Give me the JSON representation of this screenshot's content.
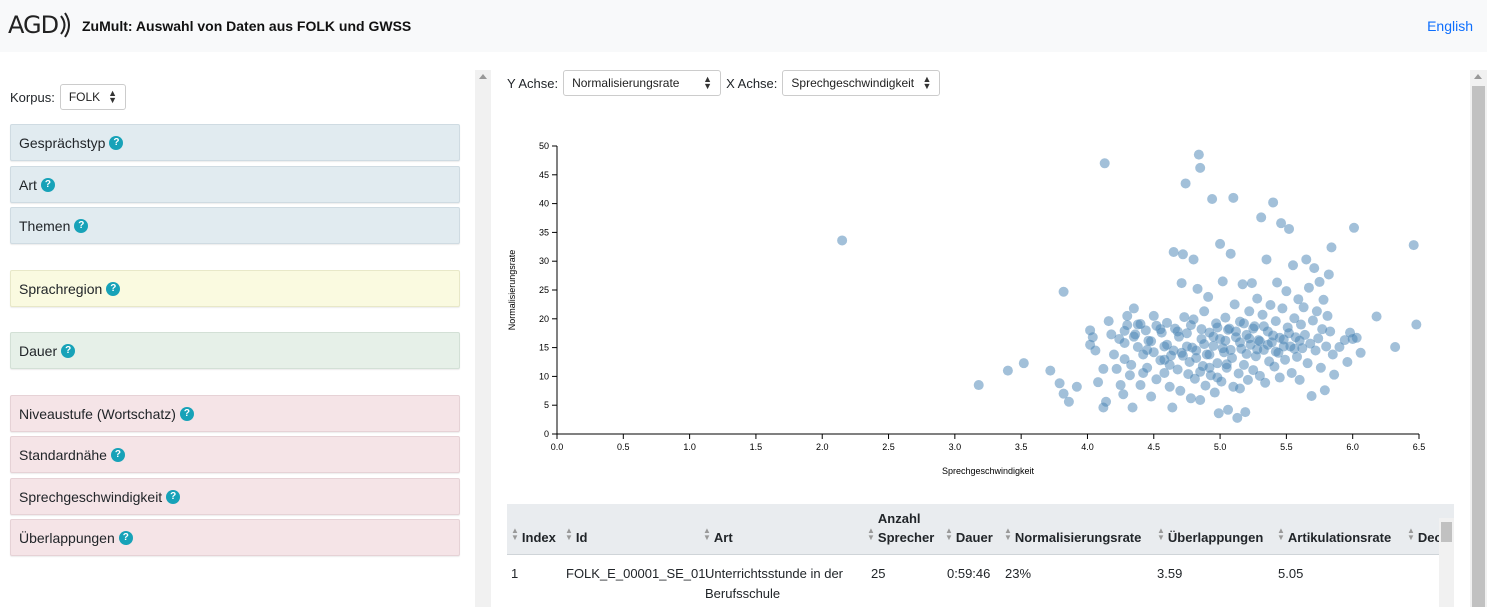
{
  "header": {
    "logo_text": "AGD",
    "title": "ZuMult: Auswahl von Daten aus FOLK und GWSS",
    "language_link": "English"
  },
  "left": {
    "korpus_label": "Korpus:",
    "korpus_value": "FOLK",
    "filters": [
      {
        "label": "Gesprächstyp",
        "group": "blue"
      },
      {
        "label": "Art",
        "group": "blue"
      },
      {
        "label": "Themen",
        "group": "blue"
      },
      {
        "label": "Sprachregion",
        "group": "yellow"
      },
      {
        "label": "Dauer",
        "group": "green"
      },
      {
        "label": "Niveaustufe (Wortschatz)",
        "group": "pink"
      },
      {
        "label": "Standardnähe",
        "group": "pink"
      },
      {
        "label": "Sprechgeschwindigkeit",
        "group": "pink"
      },
      {
        "label": "Überlappungen",
        "group": "pink"
      }
    ],
    "help_glyph": "?"
  },
  "controls": {
    "y_label": "Y Achse:",
    "y_value": "Normalisierungsrate",
    "x_label": "X Achse:",
    "x_value": "Sprechgeschwindigkeit"
  },
  "chart_data": {
    "type": "scatter",
    "xlabel": "Sprechgeschwindigkeit",
    "ylabel": "Normalisierungsrate",
    "xlim": [
      0,
      6.5
    ],
    "ylim": [
      0,
      50
    ],
    "xticks": [
      "0.0",
      "0.5",
      "1.0",
      "1.5",
      "2.0",
      "2.5",
      "3.0",
      "3.5",
      "4.0",
      "4.5",
      "5.0",
      "5.5",
      "6.0",
      "6.5"
    ],
    "yticks": [
      "0",
      "5",
      "10",
      "15",
      "20",
      "25",
      "30",
      "35",
      "40",
      "45",
      "50"
    ],
    "point_color": "#4682b4",
    "points": [
      [
        2.15,
        33.6
      ],
      [
        3.18,
        8.5
      ],
      [
        3.4,
        11
      ],
      [
        3.52,
        12.3
      ],
      [
        3.72,
        11
      ],
      [
        3.79,
        8.8
      ],
      [
        3.82,
        7
      ],
      [
        3.82,
        24.7
      ],
      [
        3.86,
        5.6
      ],
      [
        3.92,
        8.2
      ],
      [
        4.02,
        15.5
      ],
      [
        4.02,
        18
      ],
      [
        4.04,
        16.8
      ],
      [
        4.06,
        14.5
      ],
      [
        4.08,
        9
      ],
      [
        4.12,
        11.3
      ],
      [
        4.12,
        4.6
      ],
      [
        4.13,
        47
      ],
      [
        4.14,
        5.6
      ],
      [
        4.16,
        19.6
      ],
      [
        4.18,
        17.3
      ],
      [
        4.2,
        13.8
      ],
      [
        4.22,
        11.3
      ],
      [
        4.24,
        16.5
      ],
      [
        4.25,
        8.5
      ],
      [
        4.27,
        6.9
      ],
      [
        4.28,
        15.8
      ],
      [
        4.28,
        13
      ],
      [
        4.3,
        18.9
      ],
      [
        4.3,
        20.5
      ],
      [
        4.32,
        10.2
      ],
      [
        4.33,
        12
      ],
      [
        4.34,
        4.6
      ],
      [
        4.35,
        21.8
      ],
      [
        4.36,
        17.3
      ],
      [
        4.38,
        15.1
      ],
      [
        4.38,
        19
      ],
      [
        4.4,
        8.5
      ],
      [
        4.42,
        13.8
      ],
      [
        4.44,
        18
      ],
      [
        4.45,
        11.5
      ],
      [
        4.46,
        16.2
      ],
      [
        4.48,
        6.5
      ],
      [
        4.5,
        20.5
      ],
      [
        4.5,
        14.2
      ],
      [
        4.52,
        9.5
      ],
      [
        4.55,
        12.8
      ],
      [
        4.56,
        17.6
      ],
      [
        4.58,
        10.6
      ],
      [
        4.6,
        19.3
      ],
      [
        4.6,
        15.5
      ],
      [
        4.62,
        8.2
      ],
      [
        4.63,
        13.6
      ],
      [
        4.64,
        4.6
      ],
      [
        4.65,
        31.6
      ],
      [
        4.66,
        18.3
      ],
      [
        4.68,
        11.2
      ],
      [
        4.69,
        16.9
      ],
      [
        4.7,
        7.5
      ],
      [
        4.71,
        14.1
      ],
      [
        4.71,
        26.2
      ],
      [
        4.72,
        31.2
      ],
      [
        4.73,
        20.3
      ],
      [
        4.74,
        43.5
      ],
      [
        4.75,
        17.5
      ],
      [
        4.76,
        10.4
      ],
      [
        4.77,
        12.5
      ],
      [
        4.78,
        6.2
      ],
      [
        4.79,
        15
      ],
      [
        4.8,
        19.9
      ],
      [
        4.8,
        30.3
      ],
      [
        4.81,
        9.6
      ],
      [
        4.82,
        14.5
      ],
      [
        4.83,
        25.2
      ],
      [
        4.84,
        48.5
      ],
      [
        4.85,
        46.2
      ],
      [
        4.85,
        5.9
      ],
      [
        4.86,
        16.5
      ],
      [
        4.87,
        11.8
      ],
      [
        4.88,
        21.3
      ],
      [
        4.89,
        8.4
      ],
      [
        4.9,
        13.8
      ],
      [
        4.91,
        23.8
      ],
      [
        4.92,
        17.6
      ],
      [
        4.93,
        10.2
      ],
      [
        4.94,
        40.8
      ],
      [
        4.95,
        15.3
      ],
      [
        4.96,
        7.2
      ],
      [
        4.97,
        19.2
      ],
      [
        4.98,
        12.3
      ],
      [
        4.99,
        3.6
      ],
      [
        5.0,
        16.5
      ],
      [
        5.0,
        33
      ],
      [
        5.01,
        9.1
      ],
      [
        5.02,
        26.5
      ],
      [
        5.03,
        14.2
      ],
      [
        5.04,
        20.2
      ],
      [
        5.05,
        11.5
      ],
      [
        5.06,
        4.2
      ],
      [
        5.07,
        18.3
      ],
      [
        5.08,
        31.3
      ],
      [
        5.09,
        13.2
      ],
      [
        5.1,
        41
      ],
      [
        5.1,
        8.2
      ],
      [
        5.11,
        22.5
      ],
      [
        5.12,
        16.8
      ],
      [
        5.13,
        2.8
      ],
      [
        5.14,
        10.5
      ],
      [
        5.15,
        19.5
      ],
      [
        5.16,
        14.8
      ],
      [
        5.17,
        26
      ],
      [
        5.18,
        12
      ],
      [
        5.19,
        3.8
      ],
      [
        5.2,
        17.2
      ],
      [
        5.21,
        9.4
      ],
      [
        5.22,
        21.3
      ],
      [
        5.23,
        15.5
      ],
      [
        5.24,
        26.2
      ],
      [
        5.25,
        11.1
      ],
      [
        5.26,
        18.7
      ],
      [
        5.27,
        13.5
      ],
      [
        5.28,
        23.5
      ],
      [
        5.29,
        16.3
      ],
      [
        5.3,
        10.1
      ],
      [
        5.31,
        37.6
      ],
      [
        5.32,
        20.7
      ],
      [
        5.33,
        14.6
      ],
      [
        5.34,
        8.9
      ],
      [
        5.35,
        30.3
      ],
      [
        5.36,
        17.8
      ],
      [
        5.37,
        12.6
      ],
      [
        5.38,
        22.4
      ],
      [
        5.39,
        15.9
      ],
      [
        5.4,
        40.2
      ],
      [
        5.41,
        11.7
      ],
      [
        5.42,
        19.6
      ],
      [
        5.43,
        26.3
      ],
      [
        5.44,
        14.1
      ],
      [
        5.45,
        9.8
      ],
      [
        5.46,
        36.6
      ],
      [
        5.47,
        21.8
      ],
      [
        5.48,
        16.4
      ],
      [
        5.49,
        12.9
      ],
      [
        5.5,
        24.8
      ],
      [
        5.51,
        18.5
      ],
      [
        5.52,
        35.6
      ],
      [
        5.53,
        15.2
      ],
      [
        5.54,
        10.6
      ],
      [
        5.55,
        29.3
      ],
      [
        5.56,
        20.1
      ],
      [
        5.57,
        16.8
      ],
      [
        5.58,
        13.4
      ],
      [
        5.59,
        23.4
      ],
      [
        5.6,
        9.4
      ],
      [
        5.61,
        19
      ],
      [
        5.62,
        14.9
      ],
      [
        5.63,
        22
      ],
      [
        5.64,
        17.2
      ],
      [
        5.65,
        30.3
      ],
      [
        5.66,
        12.3
      ],
      [
        5.67,
        25.4
      ],
      [
        5.68,
        15.7
      ],
      [
        5.69,
        6.6
      ],
      [
        5.7,
        19.7
      ],
      [
        5.71,
        28.8
      ],
      [
        5.72,
        14.5
      ],
      [
        5.73,
        21.3
      ],
      [
        5.74,
        16.6
      ],
      [
        5.75,
        26.4
      ],
      [
        5.76,
        11.5
      ],
      [
        5.77,
        18.2
      ],
      [
        5.78,
        23.3
      ],
      [
        5.79,
        7.6
      ],
      [
        5.8,
        15.2
      ],
      [
        5.81,
        20.5
      ],
      [
        5.82,
        27.7
      ],
      [
        5.83,
        17.8
      ],
      [
        5.84,
        32.4
      ],
      [
        5.85,
        13.8
      ],
      [
        5.86,
        10.3
      ],
      [
        5.9,
        15.1
      ],
      [
        5.94,
        16.3
      ],
      [
        5.96,
        12.5
      ],
      [
        5.98,
        17.6
      ],
      [
        6.0,
        16.5
      ],
      [
        6.01,
        35.8
      ],
      [
        6.03,
        16.7
      ],
      [
        6.06,
        14.1
      ],
      [
        6.18,
        20.4
      ],
      [
        6.32,
        15.1
      ],
      [
        6.46,
        32.8
      ],
      [
        6.48,
        19
      ],
      [
        4.45,
        14.6
      ],
      [
        4.52,
        18.8
      ],
      [
        4.58,
        15.2
      ],
      [
        4.62,
        12
      ],
      [
        4.68,
        17.8
      ],
      [
        4.72,
        13.6
      ],
      [
        4.75,
        15.2
      ],
      [
        4.78,
        18.9
      ],
      [
        4.82,
        13.2
      ],
      [
        4.86,
        18.2
      ],
      [
        4.88,
        15.6
      ],
      [
        4.92,
        13.8
      ],
      [
        4.95,
        16.9
      ],
      [
        4.98,
        18.5
      ],
      [
        5.02,
        14.9
      ],
      [
        5.04,
        16.2
      ],
      [
        5.06,
        18.1
      ],
      [
        5.08,
        14.6
      ],
      [
        5.12,
        17.8
      ],
      [
        5.15,
        15.9
      ],
      [
        5.18,
        19.2
      ],
      [
        5.2,
        13.9
      ],
      [
        5.22,
        16.6
      ],
      [
        5.25,
        18.3
      ],
      [
        5.28,
        14.7
      ],
      [
        5.3,
        16.1
      ],
      [
        5.33,
        18.7
      ],
      [
        5.36,
        15.5
      ],
      [
        5.4,
        17.1
      ],
      [
        5.42,
        14.3
      ],
      [
        5.45,
        16.7
      ],
      [
        5.48,
        15.2
      ],
      [
        5.52,
        17.5
      ],
      [
        5.56,
        14.8
      ],
      [
        5.6,
        16.2
      ],
      [
        4.35,
        16.9
      ],
      [
        4.4,
        19.1
      ],
      [
        4.28,
        17.9
      ],
      [
        4.48,
        16.1
      ],
      [
        4.55,
        18.2
      ],
      [
        4.98,
        9.8
      ],
      [
        5.05,
        12.1
      ],
      [
        5.15,
        7.9
      ],
      [
        4.92,
        11.5
      ],
      [
        4.85,
        10.8
      ],
      [
        4.65,
        14.5
      ],
      [
        4.58,
        12.9
      ],
      [
        4.42,
        10.6
      ]
    ]
  },
  "table": {
    "columns": [
      "Index",
      "Id",
      "Art",
      "Anzahl Sprecher",
      "Dauer",
      "Normalisierungsrate",
      "Überlappungen",
      "Artikulationsrate",
      "Dec"
    ],
    "rows": [
      [
        "1",
        "FOLK_E_00001_SE_01",
        "Unterrichtsstunde in der Berufsschule",
        "25",
        "0:59:46",
        "23%",
        "3.59",
        "5.05",
        ""
      ]
    ]
  }
}
